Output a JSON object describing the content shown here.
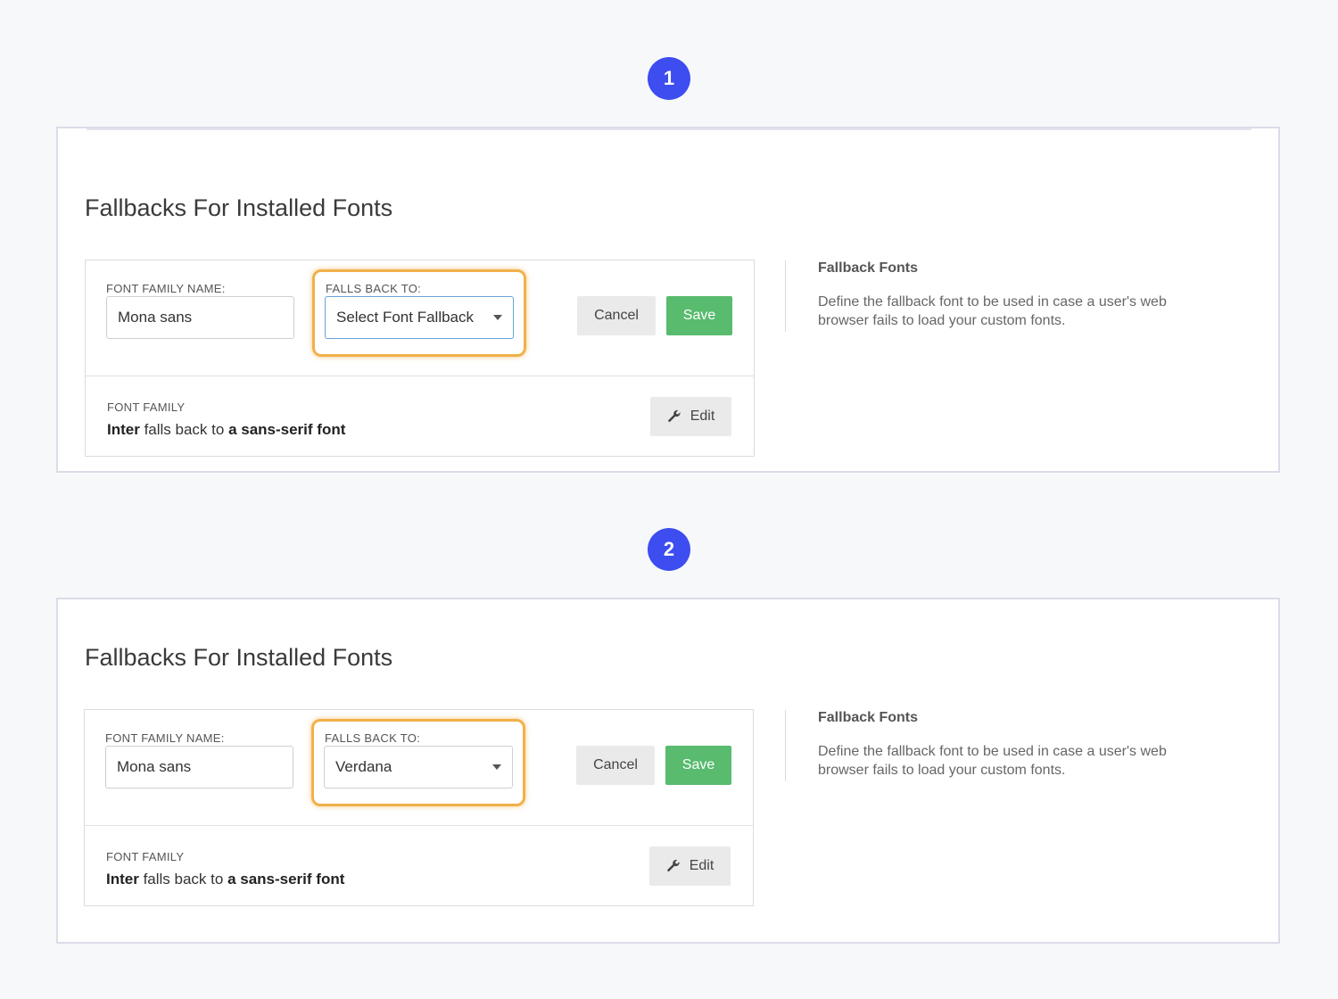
{
  "steps": [
    {
      "number": "1",
      "title": "Fallbacks For Installed Fonts",
      "font_family_label": "FONT FAMILY NAME:",
      "font_family_value": "Mona sans",
      "falls_back_label": "FALLS BACK TO:",
      "falls_back_value": "Select Font Fallback",
      "cancel_label": "Cancel",
      "save_label": "Save",
      "existing_label": "FONT FAMILY",
      "existing_font": "Inter",
      "existing_mid": " falls back to ",
      "existing_fallback": "a sans-serif font",
      "edit_label": "Edit",
      "side_title": "Fallback Fonts",
      "side_desc": "Define the fallback font to be used in case a user's web browser fails to load your custom fonts."
    },
    {
      "number": "2",
      "title": "Fallbacks For Installed Fonts",
      "font_family_label": "FONT FAMILY NAME:",
      "font_family_value": "Mona sans",
      "falls_back_label": "FALLS BACK TO:",
      "falls_back_value": "Verdana",
      "cancel_label": "Cancel",
      "save_label": "Save",
      "existing_label": "FONT FAMILY",
      "existing_font": "Inter",
      "existing_mid": " falls back to ",
      "existing_fallback": "a sans-serif font",
      "edit_label": "Edit",
      "side_title": "Fallback Fonts",
      "side_desc": "Define the fallback font to be used in case a user's web browser fails to load your custom fonts."
    }
  ],
  "colors": {
    "badge": "#3d4df0",
    "highlight": "#f0b14a",
    "save": "#58bb6e"
  },
  "icons": {
    "edit": "wrench-icon",
    "select": "caret-down-icon"
  }
}
